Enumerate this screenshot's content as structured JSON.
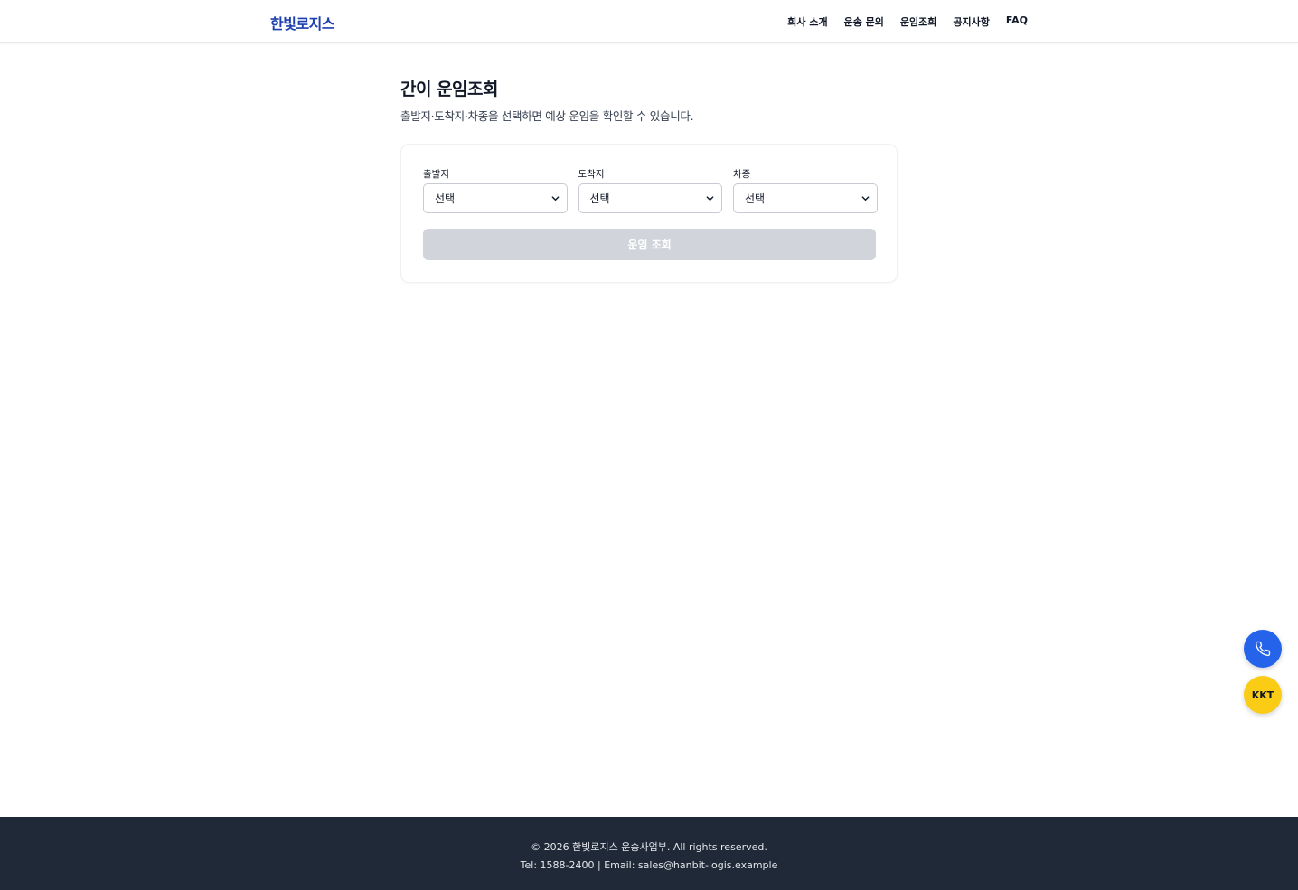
{
  "header": {
    "logo": "한빛로지스",
    "nav": [
      "회사 소개",
      "운송 문의",
      "운임조회",
      "공지사항",
      "FAQ"
    ]
  },
  "main": {
    "title": "간이 운임조회",
    "subtitle": "출발지·도착지·차종을 선택하면 예상 운임을 확인할 수 있습니다.",
    "fields": [
      {
        "label": "출발지",
        "value": "선택"
      },
      {
        "label": "도착지",
        "value": "선택"
      },
      {
        "label": "차종",
        "value": "선택"
      }
    ],
    "submit_label": "운임 조회",
    "submit_disabled": true
  },
  "floating": {
    "phone_icon": "phone-icon",
    "kakao_label": "KKT"
  },
  "footer": {
    "copyright": "© 2026 한빛로지스 운송사업부. All rights reserved.",
    "contact": "Tel: 1588-2400 | Email: sales@hanbit-logis.example"
  },
  "colors": {
    "brand": "#1e40af",
    "phone_fab": "#2563eb",
    "kakao_fab": "#facc15",
    "footer_bg": "#1f2937",
    "button_disabled": "#d1d5db"
  }
}
